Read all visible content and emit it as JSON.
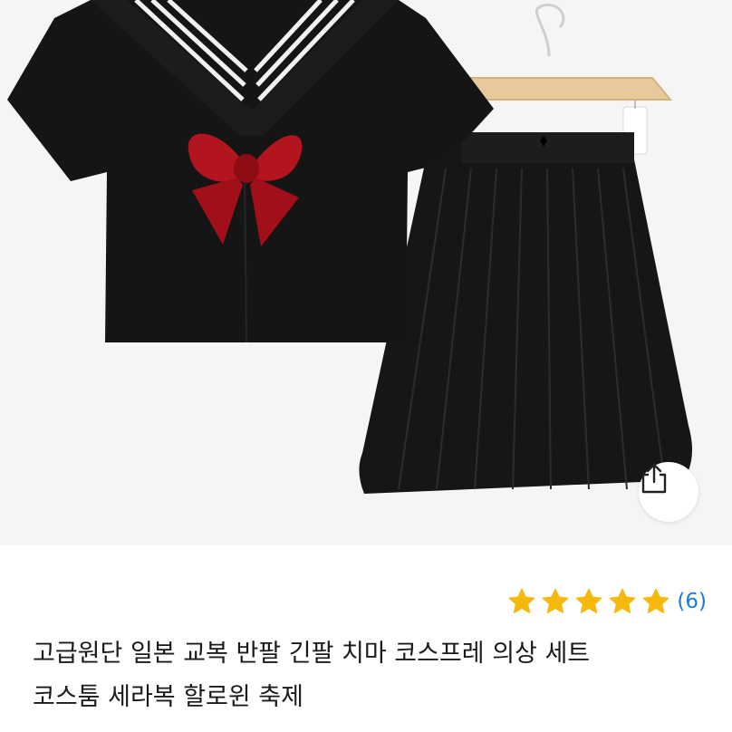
{
  "product": {
    "title_line1": "고급원단 일본 교복 반팔 긴팔 치마 코스프레 의상 세트",
    "title_line2": "코스툼 세라복 할로윈 축제",
    "rating_stars": 5,
    "rating_count": "(6)"
  },
  "icons": {
    "share": "share-icon",
    "star": "star-icon"
  },
  "colors": {
    "star": "#f6b80f",
    "link": "#1d7bd6",
    "bow": "#b3151f",
    "garment": "#141414"
  }
}
